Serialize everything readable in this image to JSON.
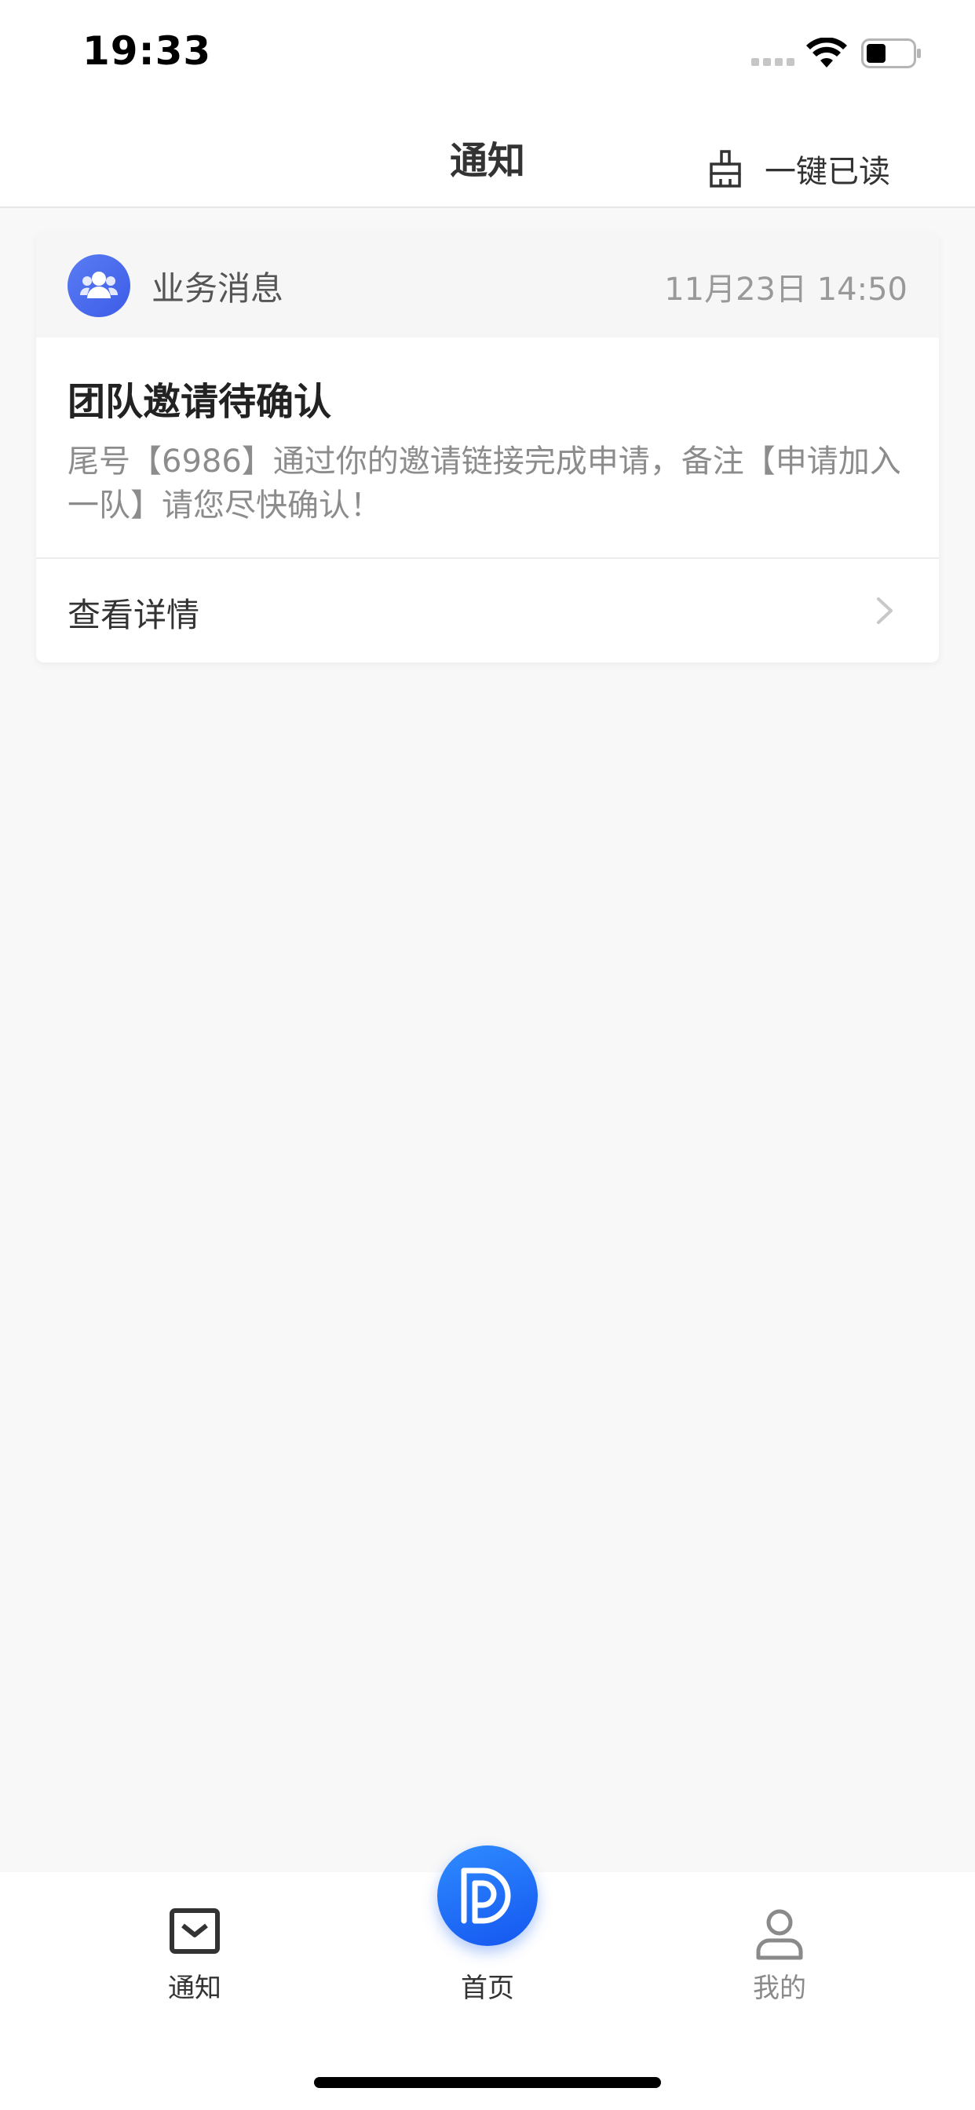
{
  "status_bar": {
    "time": "19:33"
  },
  "nav": {
    "title": "通知",
    "read_all_label": "一键已读"
  },
  "notification": {
    "category": "业务消息",
    "time": "11月23日 14:50",
    "title": "团队邀请待确认",
    "body": "尾号【6986】通过你的邀请链接完成申请，备注【申请加入一队】请您尽快确认！",
    "detail_label": "查看详情"
  },
  "tabs": [
    {
      "label": "通知",
      "icon": "mail-icon",
      "active": true
    },
    {
      "label": "首页",
      "icon": "home-logo-icon",
      "active": false
    },
    {
      "label": "我的",
      "icon": "user-icon",
      "active": false
    }
  ],
  "colors": {
    "accent": "#1a6cf5",
    "category_avatar": "#4a6cef",
    "background": "#f8f8f8"
  }
}
